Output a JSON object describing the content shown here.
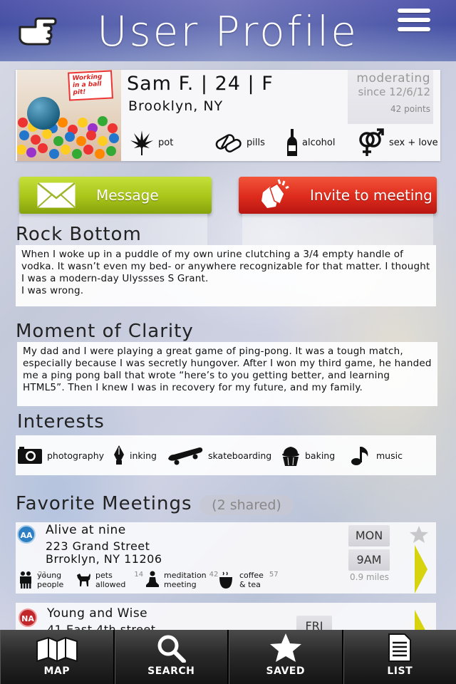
{
  "header": {
    "title": "User Profile",
    "back_icon": "pointing-hand-icon",
    "menu_icon": "hamburger-menu-icon"
  },
  "profile": {
    "photo_sign_text": "Working in a ball pit!",
    "name_line": "Sam F. | 24 | F",
    "location": "Brooklyn, NY",
    "moderating": "moderating",
    "since": "since 12/6/12",
    "points": "42 points",
    "substances": [
      {
        "label": "pot",
        "icon": "cannabis-leaf-icon"
      },
      {
        "label": "pills",
        "icon": "pills-icon"
      },
      {
        "label": "alcohol",
        "icon": "bottle-icon"
      },
      {
        "label": "sex + love",
        "icon": "gender-symbols-icon"
      }
    ]
  },
  "actions": {
    "message_label": "Message",
    "invite_label": "Invite to meeting",
    "message_color": "#a9c51a",
    "invite_color": "#dd2a1c"
  },
  "rock_bottom": {
    "title": "Rock Bottom",
    "text": "When I woke up in a puddle of my own urine clutching a 3/4 empty handle of vodka. It wasn’t even my bed- or anywhere recognizable for that matter. I thought I was a modern-day Ulyssses S Grant.\nI was wrong."
  },
  "clarity": {
    "title": "Moment of Clarity",
    "text": "My dad and I were playing a great game of ping-pong. It was a tough match, especially because I was secretly hungover. After I won my third game, he handed me a ping pong ball that wrote “here’s to you getting better, and learning HTML5”. Then I knew I was in recovery for my future, and my family."
  },
  "interests": {
    "title": "Interests",
    "items": [
      {
        "label": "photography",
        "icon": "camera-icon"
      },
      {
        "label": "inking",
        "icon": "pen-nib-icon"
      },
      {
        "label": "skateboarding",
        "icon": "skateboard-icon"
      },
      {
        "label": "baking",
        "icon": "cupcake-icon"
      },
      {
        "label": "music",
        "icon": "music-note-icon"
      }
    ]
  },
  "favorites": {
    "title": "Favorite Meetings",
    "shared": "(2 shared)",
    "meetings": [
      {
        "badge": "AA",
        "badge_color": "#2b7fc2",
        "name": "Alive at nine",
        "address1": "223 Grand Street",
        "address2": "Brroklyn, NY 11206",
        "day": "MON",
        "time": "9AM",
        "distance": "0.9 miles",
        "tags": [
          {
            "line1": "young",
            "line2": "people",
            "count": "21",
            "icon": "people-icon"
          },
          {
            "line1": "pets",
            "line2": "allowed",
            "count": "14",
            "icon": "dog-icon"
          },
          {
            "line1": "meditation",
            "line2": "meeting",
            "count": "42",
            "icon": "meditation-icon"
          },
          {
            "line1": "coffee",
            "line2": "& tea",
            "count": "57",
            "icon": "coffee-icon"
          }
        ]
      },
      {
        "badge": "NA",
        "badge_color": "#c0262a",
        "name": "Young and Wise",
        "address1": "41 East 4th street",
        "day": "FRI"
      }
    ]
  },
  "tabs": [
    {
      "label": "MAP",
      "icon": "map-icon"
    },
    {
      "label": "SEARCH",
      "icon": "search-icon"
    },
    {
      "label": "SAVED",
      "icon": "star-icon"
    },
    {
      "label": "LIST",
      "icon": "list-icon"
    }
  ]
}
